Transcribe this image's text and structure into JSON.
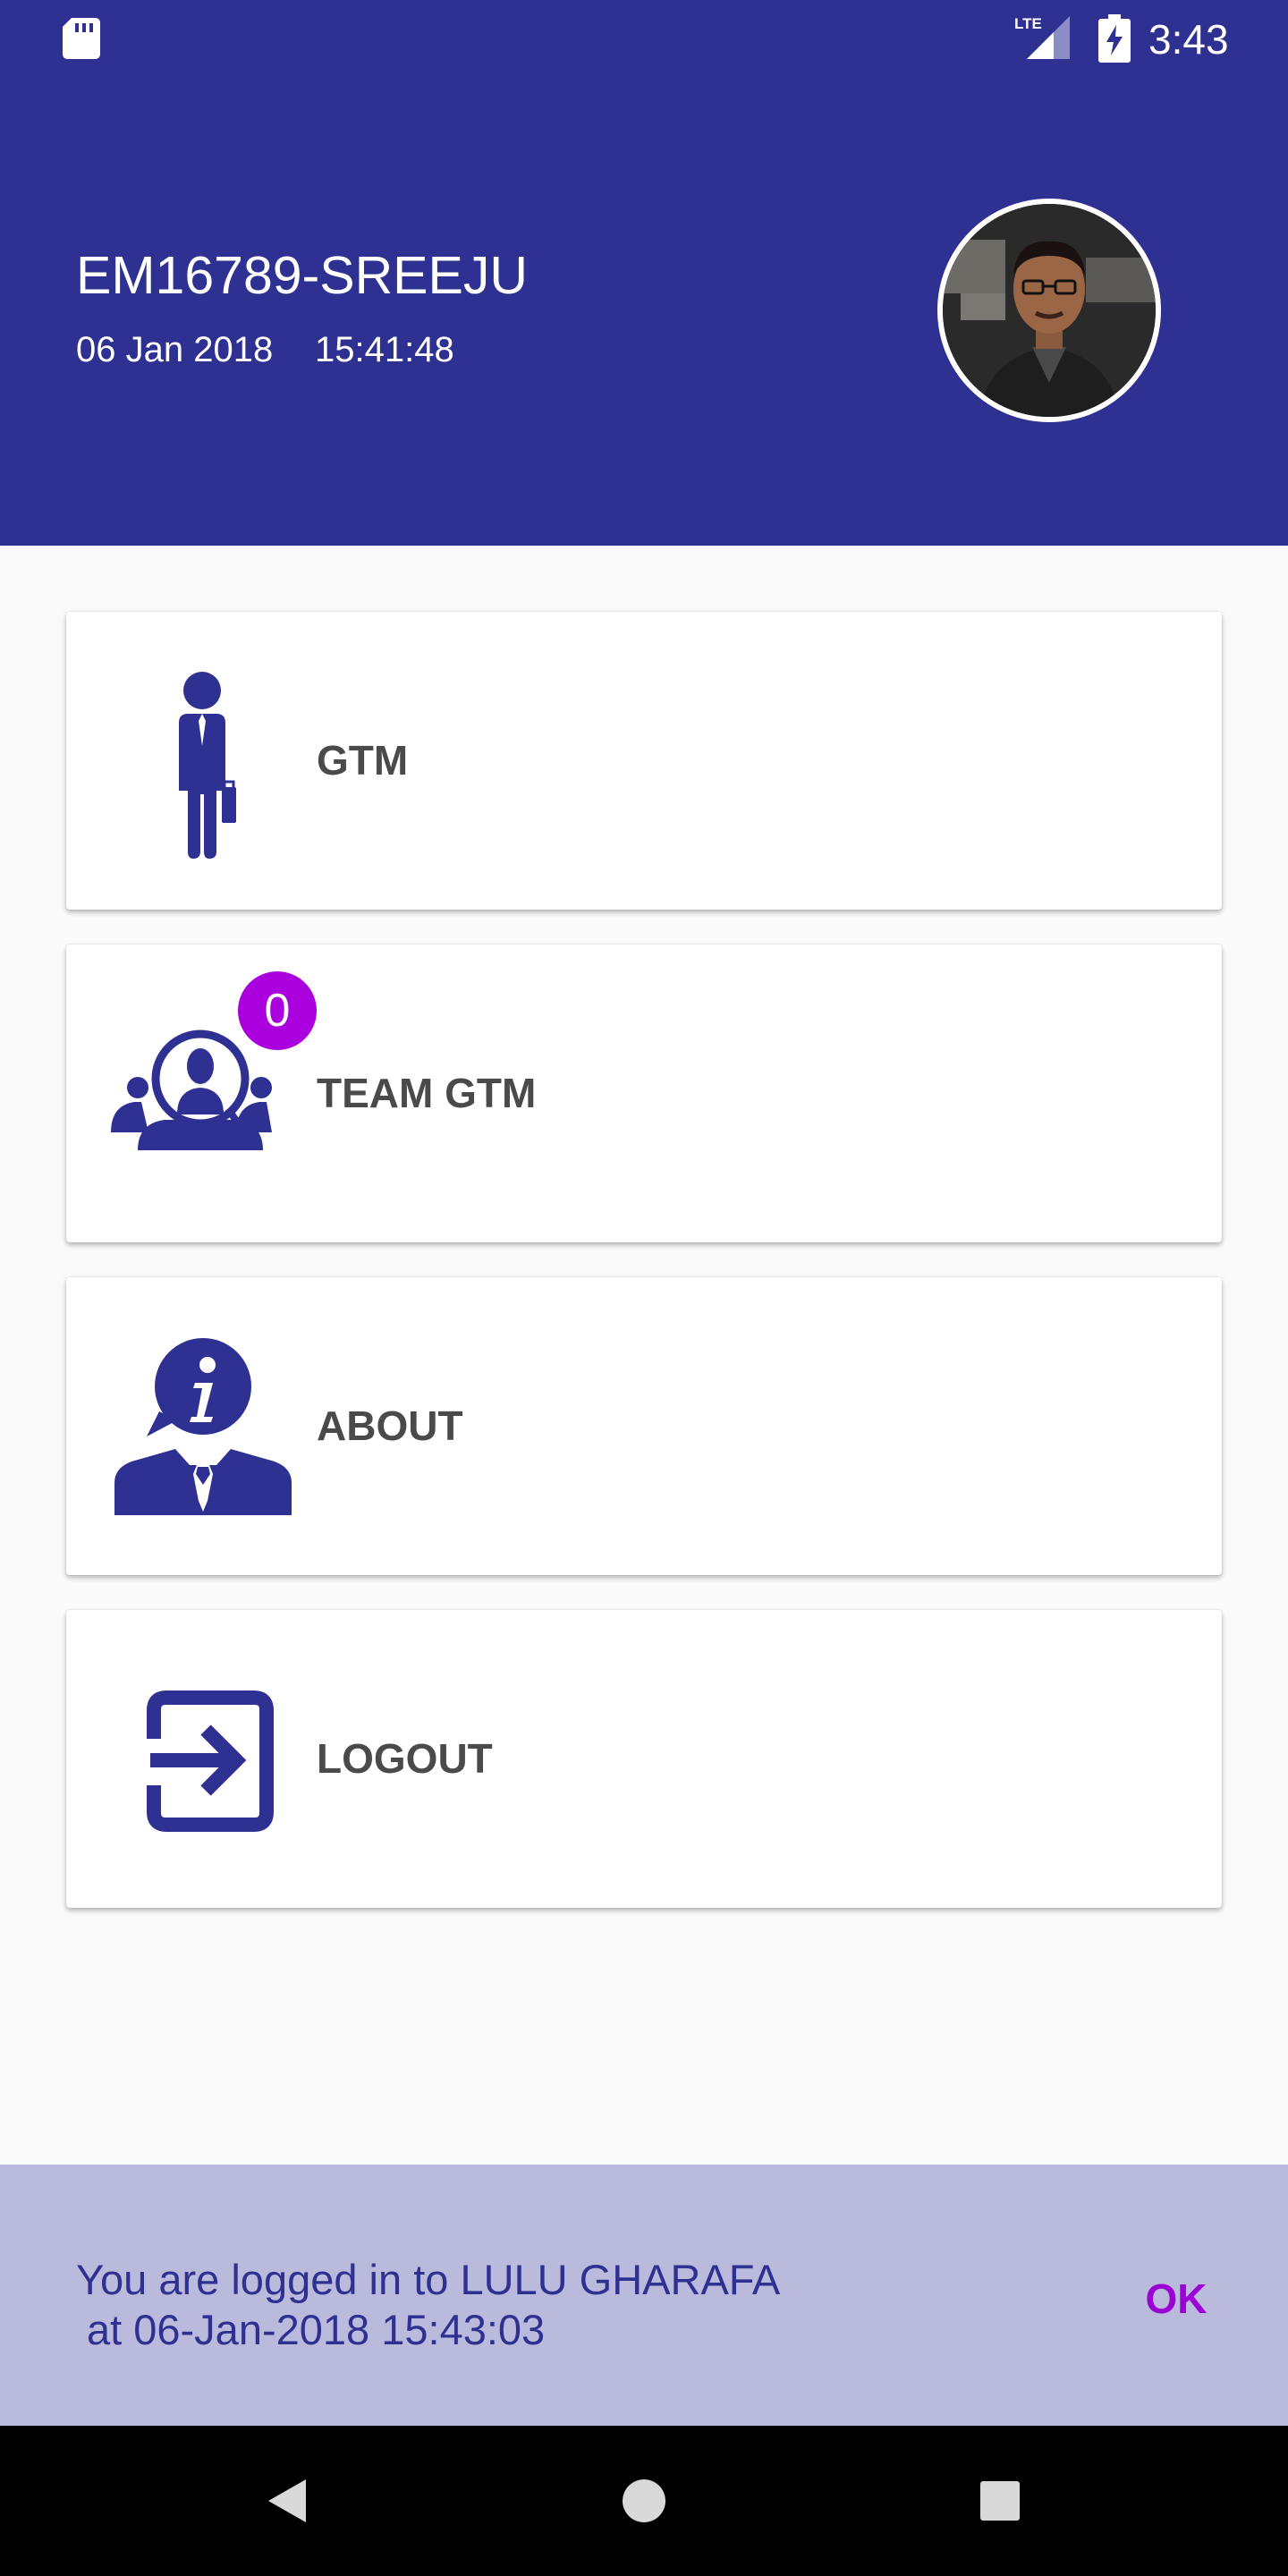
{
  "status_bar": {
    "time": "3:43",
    "network_label": "LTE",
    "icons": [
      "sd-card-icon",
      "lte-signal-icon",
      "battery-charging-icon"
    ]
  },
  "header": {
    "user_id_name": "EM16789-SREEJU",
    "date": "06 Jan 2018",
    "time": "15:41:48",
    "avatar_icon": "avatar-photo",
    "background_color": "#2e3192"
  },
  "menu": {
    "items": [
      {
        "label": "GTM",
        "icon": "businessman-icon"
      },
      {
        "label": "TEAM GTM",
        "icon": "team-search-icon",
        "badge": "0"
      },
      {
        "label": "ABOUT",
        "icon": "info-person-icon"
      },
      {
        "label": "LOGOUT",
        "icon": "logout-icon"
      }
    ],
    "icon_color": "#2e3192",
    "badge_color": "#aa00dd"
  },
  "snackbar": {
    "message_line1": "You are logged in to LULU GHARAFA",
    "message_line2": "at 06-Jan-2018 15:43:03",
    "action_label": "OK",
    "background_color": "#babadc",
    "action_color": "#9b00d4"
  },
  "nav_bar": {
    "buttons": [
      "back-icon",
      "home-icon",
      "recents-icon"
    ]
  }
}
